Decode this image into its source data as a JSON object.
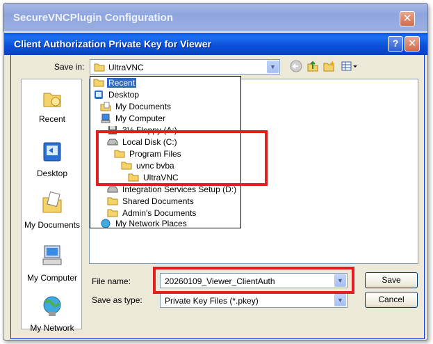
{
  "outer_window": {
    "title": "SecureVNCPlugin Configuration"
  },
  "dialog": {
    "title": "Client Authorization Private Key for Viewer"
  },
  "save_in": {
    "label": "Save in:",
    "value": "UltraVNC"
  },
  "places": [
    {
      "label": "Recent",
      "icon": "recent-folder-icon"
    },
    {
      "label": "Desktop",
      "icon": "desktop-icon"
    },
    {
      "label": "My Documents",
      "icon": "my-documents-icon"
    },
    {
      "label": "My Computer",
      "icon": "my-computer-icon"
    },
    {
      "label": "My Network",
      "icon": "my-network-icon"
    }
  ],
  "dropdown_items": [
    {
      "label": "Recent",
      "icon": "folder-icon",
      "selected": true
    },
    {
      "label": "Desktop",
      "icon": "desktop-icon"
    },
    {
      "label": "My Documents",
      "icon": "my-documents-icon"
    },
    {
      "label": "My Computer",
      "icon": "my-computer-icon"
    },
    {
      "label": "3½ Floppy (A:)",
      "icon": "floppy-icon"
    },
    {
      "label": "Local Disk (C:)",
      "icon": "drive-icon"
    },
    {
      "label": "Program Files",
      "icon": "folder-icon"
    },
    {
      "label": "uvnc bvba",
      "icon": "folder-icon"
    },
    {
      "label": "UltraVNC",
      "icon": "folder-icon"
    },
    {
      "label": "Integration Services Setup (D:)",
      "icon": "cd-drive-icon"
    },
    {
      "label": "Shared Documents",
      "icon": "folder-icon"
    },
    {
      "label": "Admin's Documents",
      "icon": "folder-icon"
    },
    {
      "label": "My Network Places",
      "icon": "network-places-icon"
    }
  ],
  "file_name": {
    "label": "File name:",
    "value": "20260109_Viewer_ClientAuth"
  },
  "save_as_type": {
    "label": "Save as type:",
    "value": "Private Key Files (*.pkey)"
  },
  "buttons": {
    "save": "Save",
    "cancel": "Cancel"
  },
  "colors": {
    "highlight": "#e11f1f",
    "selection": "#316ac5",
    "titlebar": "#0a58e6"
  }
}
